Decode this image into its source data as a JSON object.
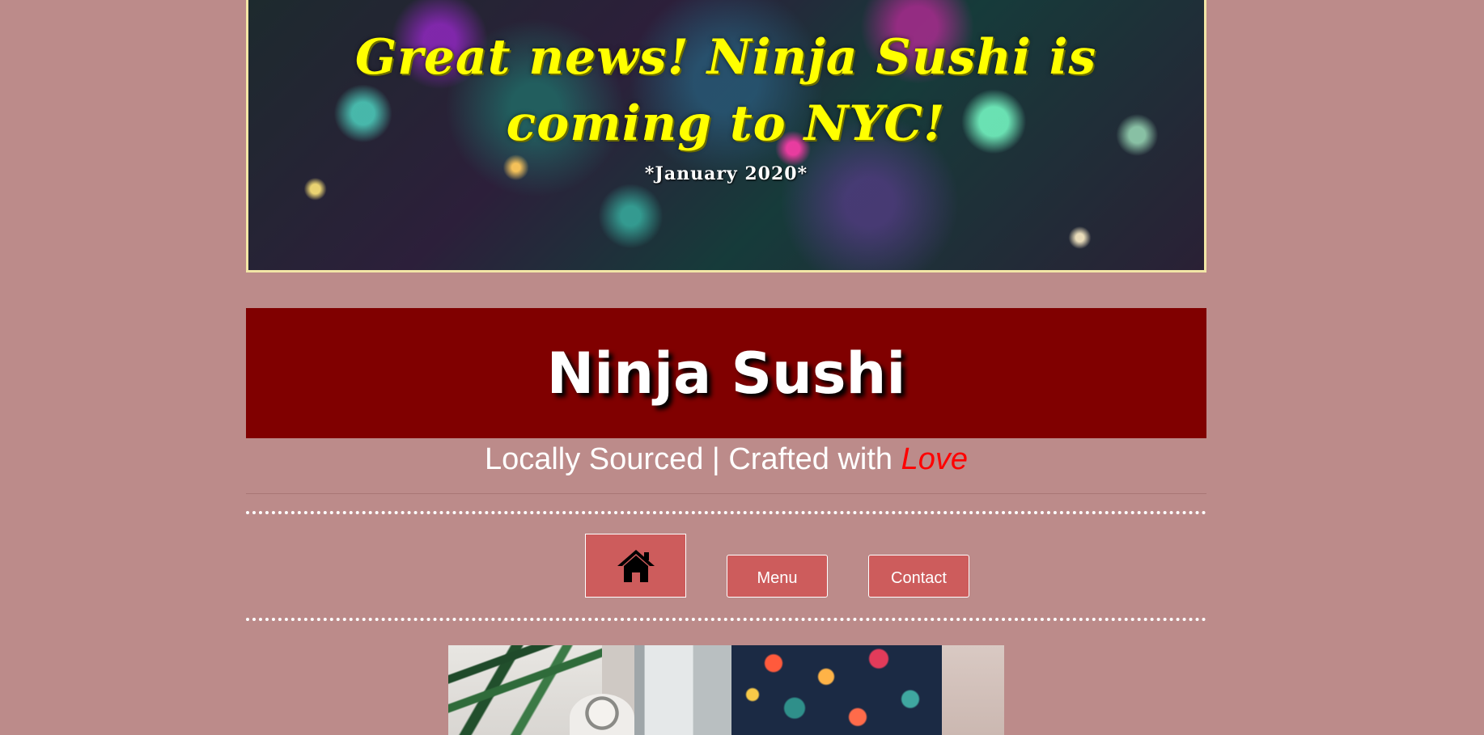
{
  "banner": {
    "headline": "Great news! Ninja Sushi is coming to NYC!",
    "date": "*January 2020*"
  },
  "site": {
    "title": "Ninja Sushi",
    "tagline_prefix": "Locally Sourced | Crafted with ",
    "tagline_emphasis": "Love"
  },
  "nav": {
    "home_icon": "home-icon",
    "menu_label": "Menu",
    "contact_label": "Contact"
  },
  "colors": {
    "page_background": "#bc8b8a",
    "title_bar": "#800000",
    "nav_button": "#cd5c5c",
    "headline": "#ffff00",
    "love": "#ff0000"
  }
}
